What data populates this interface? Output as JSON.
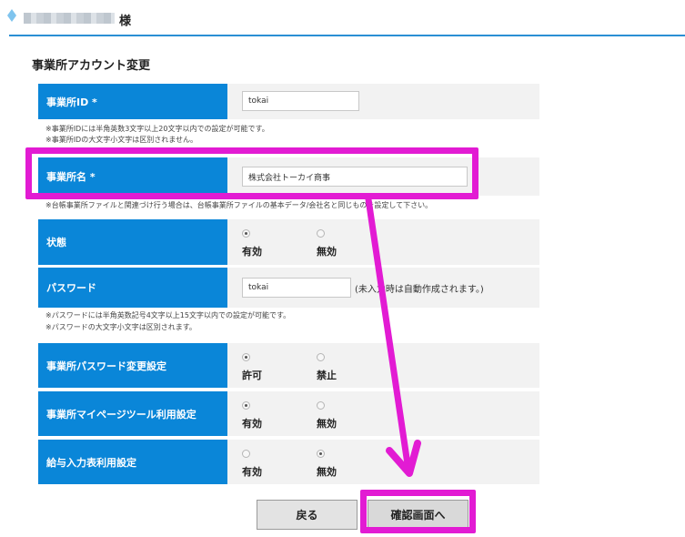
{
  "header": {
    "greeting_suffix": "様"
  },
  "page_title": "事業所アカウント変更",
  "fields": {
    "office_id": {
      "label": "事業所ID *",
      "value": "tokai",
      "notes": [
        "※事業所IDには半角英数3文字以上20文字以内での設定が可能です。",
        "※事業所IDの大文字小文字は区別されません。"
      ]
    },
    "office_name": {
      "label": "事業所名 *",
      "value": "株式会社トーカイ商事",
      "note": "※台帳事業所ファイルと関連づけ行う場合は、台帳事業所ファイルの基本データ/会社名と同じものを設定して下さい。"
    },
    "status": {
      "label": "状態",
      "options": [
        "有効",
        "無効"
      ],
      "selected": "有効"
    },
    "password": {
      "label": "パスワード",
      "value": "tokai",
      "suffix": "(未入力時は自動作成されます。)",
      "notes": [
        "※パスワードには半角英数記号4文字以上15文字以内での設定が可能です。",
        "※パスワードの大文字小文字は区別されます。"
      ]
    },
    "pw_change": {
      "label": "事業所パスワード変更設定",
      "options": [
        "許可",
        "禁止"
      ],
      "selected": "許可"
    },
    "mypage_tool": {
      "label": "事業所マイページツール利用設定",
      "options": [
        "有効",
        "無効"
      ],
      "selected": "有効"
    },
    "salary_input": {
      "label": "給与入力表利用設定",
      "options": [
        "有効",
        "無効"
      ],
      "selected": "無効"
    }
  },
  "buttons": {
    "back": "戻る",
    "confirm": "確認画面へ"
  },
  "colors": {
    "accent_blue": "#0a86d8",
    "annotation_magenta": "#e21bd3"
  }
}
